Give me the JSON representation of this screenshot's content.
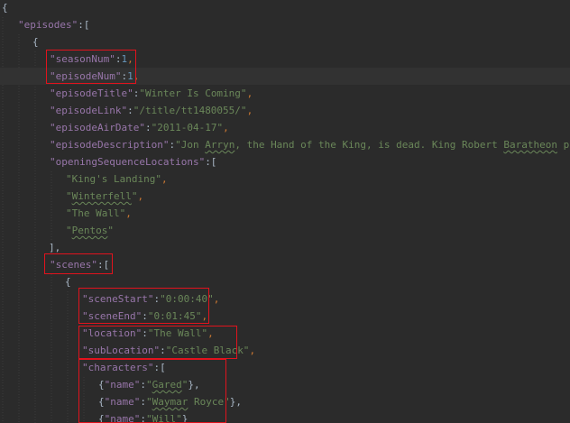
{
  "editor": {
    "theme_colors": {
      "background": "#2b2b2b",
      "key": "#9876aa",
      "string": "#6a8759",
      "number": "#6897bb",
      "punctuation": "#cc7832",
      "highlight_box": "#e1131d"
    },
    "lines": {
      "l1_open": "{",
      "l2_key": "\"episodes\"",
      "l2_rest": ":[",
      "l3_open": "{",
      "l4_key": "\"seasonNum\"",
      "l4_colon": ":",
      "l4_val": "1",
      "l4_comma": ",",
      "l5_key": "\"episodeNum\"",
      "l5_colon": ":",
      "l5_val": "1",
      "l5_comma": ",",
      "l6_key": "\"episodeTitle\"",
      "l6_colon": ":",
      "l6_val": "\"Winter Is Coming\"",
      "l6_comma": ",",
      "l7_key": "\"episodeLink\"",
      "l7_colon": ":",
      "l7_val": "\"/title/tt1480055/\"",
      "l7_comma": ",",
      "l8_key": "\"episodeAirDate\"",
      "l8_colon": ":",
      "l8_val": "\"2011-04-17\"",
      "l8_comma": ",",
      "l9_key": "\"episodeDescription\"",
      "l9_colon": ":",
      "l9_val_a": "\"Jon ",
      "l9_val_b": "Arryn",
      "l9_val_c": ", the Hand of the King, is dead. King Robert ",
      "l9_val_d": "Baratheon",
      "l9_val_e": " plans to as",
      "l10_key": "\"openingSequenceLocations\"",
      "l10_rest": ":[",
      "l11_val": "\"King's Landing\"",
      "l11_comma": ",",
      "l12_q1": "\"",
      "l12_word": "Winterfell",
      "l12_q2": "\"",
      "l12_comma": ",",
      "l13_val": "\"The Wall\"",
      "l13_comma": ",",
      "l14_q1": "\"",
      "l14_word": "Pentos",
      "l14_q2": "\"",
      "l15_close": "],",
      "l16_key": "\"scenes\"",
      "l16_rest": ":[",
      "l17_open": "{",
      "l18_key": "\"sceneStart\"",
      "l18_colon": ":",
      "l18_val": "\"0:00:40\"",
      "l18_comma": ",",
      "l19_key": "\"sceneEnd\"",
      "l19_colon": ":",
      "l19_val": "\"0:01:45\"",
      "l19_comma": ",",
      "l20_key": "\"location\"",
      "l20_colon": ":",
      "l20_val": "\"The Wall\"",
      "l20_comma": ",",
      "l21_key": "\"subLocation\"",
      "l21_colon": ":",
      "l21_val": "\"Castle Black\"",
      "l21_comma": ",",
      "l22_key": "\"characters\"",
      "l22_rest": ":[",
      "l23_open": "{",
      "l23_key": "\"name\"",
      "l23_colon": ":",
      "l23_q1": "\"",
      "l23_word": "Gared",
      "l23_q2": "\"",
      "l23_close": "},",
      "l24_open": "{",
      "l24_key": "\"name\"",
      "l24_colon": ":",
      "l24_q1": "\"",
      "l24_word": "Waymar",
      "l24_val_rest": " Royce\"",
      "l24_close": "},",
      "l25_open": "{",
      "l25_key": "\"name\"",
      "l25_colon": ":",
      "l25_val": "\"Will\"",
      "l25_close": "}"
    }
  }
}
